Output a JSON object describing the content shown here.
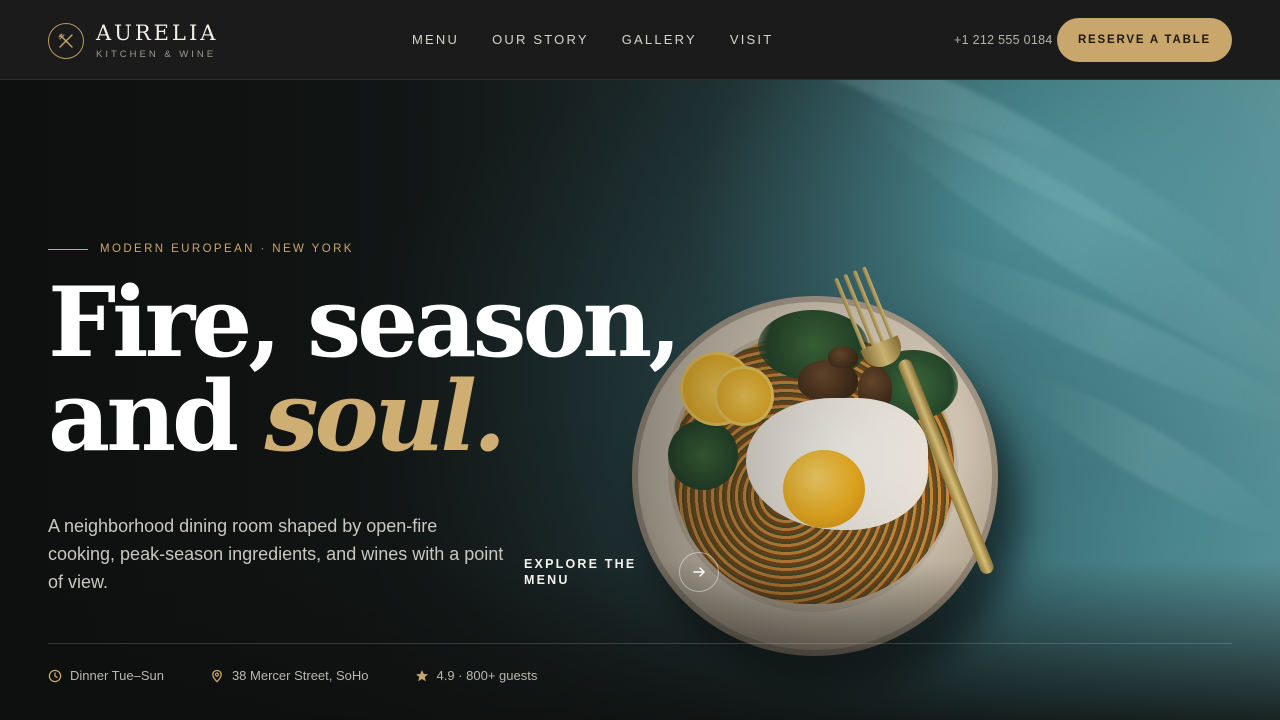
{
  "brand": {
    "name": "AURELIA",
    "tagline": "KITCHEN & WINE",
    "accent_color": "#c9a66b",
    "logo_icon": "crossed-utensils-icon"
  },
  "nav": {
    "items": [
      {
        "label": "MENU"
      },
      {
        "label": "OUR STORY"
      },
      {
        "label": "GALLERY"
      },
      {
        "label": "VISIT"
      }
    ]
  },
  "header": {
    "phone": "+1 212 555 0184",
    "reserve_label": "RESERVE A TABLE"
  },
  "hero": {
    "eyebrow": "MODERN EUROPEAN · NEW YORK",
    "headline_line1": "Fire, season,",
    "headline_line2_plain": "and",
    "headline_line2_accent": "soul.",
    "lede": "A neighborhood dining room shaped by open-fire cooking, peak-season ingredients, and wines with a point of view.",
    "cta_label": "EXPLORE THE MENU",
    "cta_icon": "arrow-right-icon",
    "image": "plate-of-pasta-with-fried-egg-and-fork"
  },
  "meta": {
    "hours": {
      "icon": "clock-icon",
      "text": "Dinner Tue–Sun"
    },
    "address": {
      "icon": "map-pin-icon",
      "text": "38 Mercer Street, SoHo"
    },
    "rating": {
      "icon": "star-icon",
      "text": "4.9 · 800+ guests"
    }
  }
}
